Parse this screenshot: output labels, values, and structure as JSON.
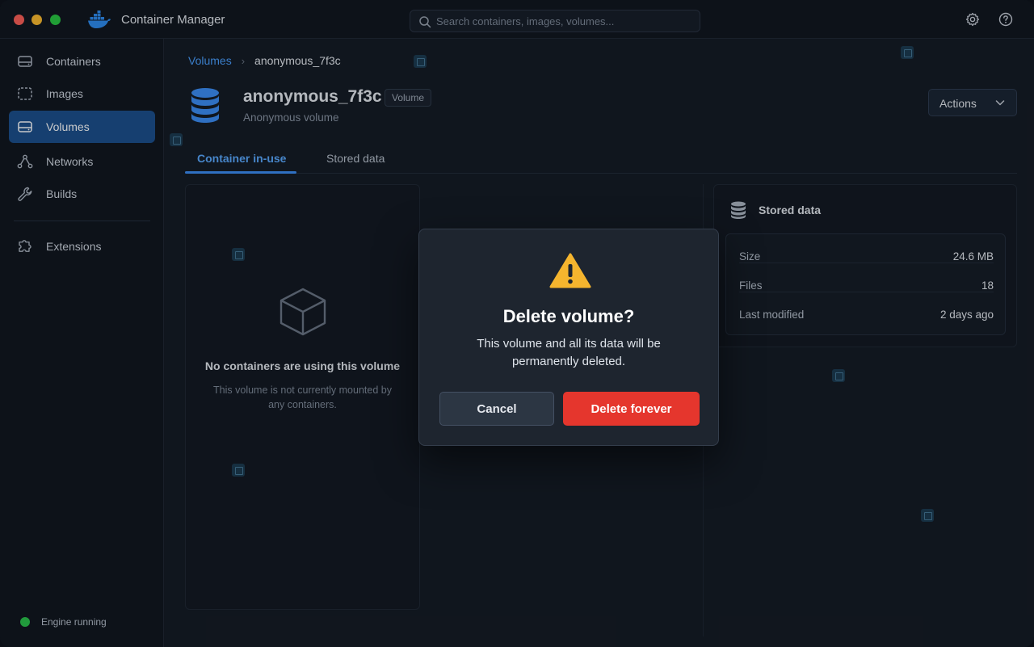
{
  "app": {
    "title": "Container Manager"
  },
  "search": {
    "placeholder": "Search containers, images, volumes..."
  },
  "titlebar": {
    "icons": [
      "settings-icon",
      "help-icon"
    ]
  },
  "sidebar": {
    "items": [
      {
        "label": "Containers",
        "icon": "container-icon"
      },
      {
        "label": "Images",
        "icon": "image-icon"
      },
      {
        "label": "Volumes",
        "icon": "volume-icon",
        "active": true
      },
      {
        "label": "Networks",
        "icon": "network-icon"
      },
      {
        "label": "Builds",
        "icon": "wrench-icon"
      },
      {
        "label": "Extensions",
        "icon": "puzzle-icon"
      }
    ],
    "engine_status": "Engine running"
  },
  "breadcrumb": {
    "parent": "Volumes",
    "separator": "›",
    "current": "anonymous_7f3c"
  },
  "volume": {
    "name": "anonymous_7f3c",
    "badge": "Volume",
    "subtitle": "Anonymous volume"
  },
  "header": {
    "actions_label": "Actions"
  },
  "tabs": [
    {
      "label": "Container in-use",
      "active": true
    },
    {
      "label": "Stored data",
      "active": false
    }
  ],
  "empty_state": {
    "title": "No containers are using this volume",
    "description": "This volume is not currently mounted by any containers."
  },
  "stored_data": {
    "title": "Stored data",
    "rows": [
      {
        "key": "Size",
        "value": "24.6 MB"
      },
      {
        "key": "Files",
        "value": "18"
      },
      {
        "key": "Last modified",
        "value": "2 days ago"
      }
    ]
  },
  "dialog": {
    "title": "Delete volume?",
    "body": "This volume and all its data will be permanently deleted.",
    "cancel_label": "Cancel",
    "confirm_label": "Delete forever"
  },
  "colors": {
    "accent": "#3b8df5",
    "active_nav": "#1b4f8c",
    "danger": "#e5362d",
    "warning": "#f5b52e",
    "engine_ok": "#2ac34a"
  }
}
